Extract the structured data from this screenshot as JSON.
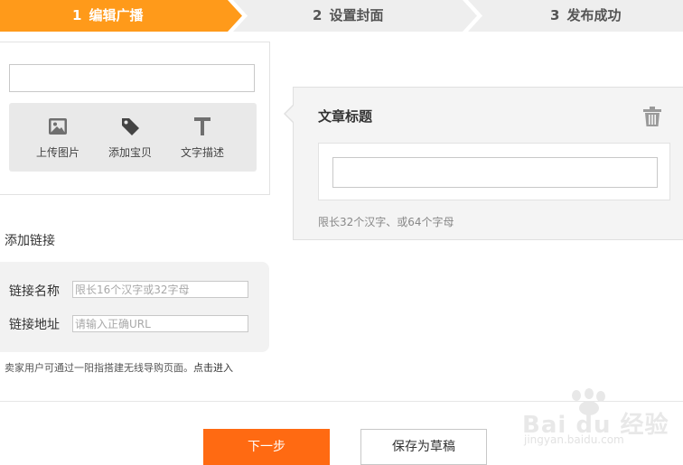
{
  "steps": [
    {
      "num": "1",
      "label": "编辑广播"
    },
    {
      "num": "2",
      "label": "设置封面"
    },
    {
      "num": "3",
      "label": "发布成功"
    }
  ],
  "colors": {
    "active_step": "#ff9a1a",
    "inactive_step": "#eeeeee",
    "primary_button": "#ff6a12"
  },
  "editor": {
    "tools": [
      {
        "icon": "image-icon",
        "label": "上传图片"
      },
      {
        "icon": "tag-icon",
        "label": "添加宝贝"
      },
      {
        "icon": "text-icon",
        "label": "文字描述"
      }
    ]
  },
  "link": {
    "title": "添加链接",
    "name_label": "链接名称",
    "name_placeholder": "限长16个汉字或32字母",
    "url_label": "链接地址",
    "url_placeholder": "请输入正确URL",
    "note": "卖家用户可通过一阳指搭建无线导购页面。",
    "note_link": "点击进入"
  },
  "article": {
    "title_label": "文章标题",
    "limit_note": "限长32个汉字、或64个字母"
  },
  "buttons": {
    "next": "下一步",
    "draft": "保存为草稿"
  },
  "watermark": {
    "brand": "Bai du 经验",
    "url": "jingyan.baidu.com"
  }
}
